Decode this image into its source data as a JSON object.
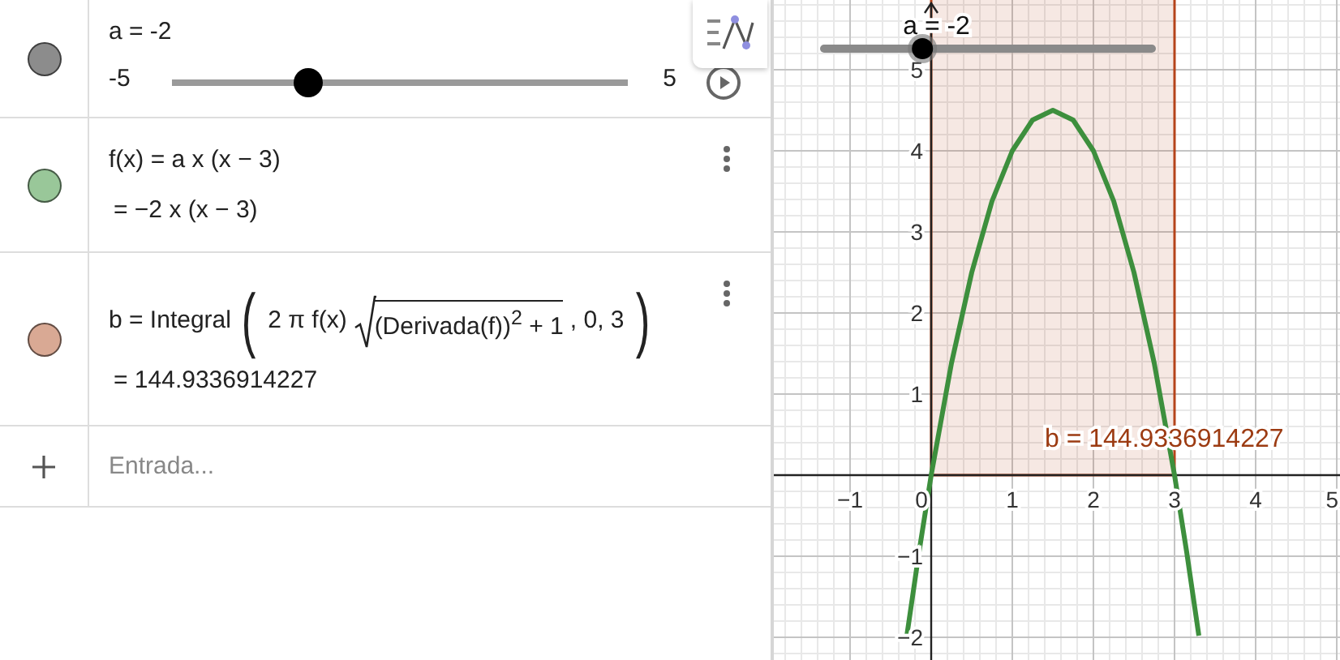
{
  "algebra": {
    "rows": [
      {
        "kind": "slider",
        "color": "#8c8c8c",
        "definition": "a = -2",
        "min": "-5",
        "max": "5",
        "level": 0.3
      },
      {
        "kind": "function",
        "color": "#99c799",
        "definition": "f(x) = a x (x − 3)",
        "value": "= −2 x (x − 3)"
      },
      {
        "kind": "integral",
        "color": "#d9a994",
        "lhs": "b = Integral",
        "open": "(",
        "before_root": "2 π f(x)",
        "radicand": "(Derivada(f))$^{2}$ + 1",
        "after_root": ", 0, 3",
        "close": ")",
        "value": "= 144.9336914227"
      },
      {
        "kind": "input",
        "placeholder": "Entrada..."
      }
    ]
  },
  "graph": {
    "slider": {
      "label": "a = -2",
      "level": 0.3
    },
    "chart_data": {
      "type": "line",
      "x": [
        -0.3,
        -0.15,
        0,
        0.25,
        0.5,
        0.75,
        1,
        1.25,
        1.5,
        1.75,
        2,
        2.25,
        2.5,
        2.75,
        3,
        3.15,
        3.3
      ],
      "series": [
        {
          "color": "#3d8f3d",
          "values": [
            -1.98,
            -0.95,
            0,
            1.38,
            2.5,
            3.38,
            4,
            4.38,
            4.5,
            4.38,
            4,
            3.38,
            2.5,
            1.38,
            0,
            -0.95,
            -1.98
          ]
        }
      ],
      "grid": true,
      "xlim": [
        -1.94,
        5.04
      ],
      "ylim": [
        -2.28,
        5.86
      ],
      "xticks": [
        -1,
        0,
        1,
        2,
        3,
        4,
        5
      ],
      "yticks": [
        -2,
        -1,
        1,
        2,
        3,
        4,
        5
      ],
      "annotations": [
        "b = 144.9336914227"
      ]
    }
  }
}
